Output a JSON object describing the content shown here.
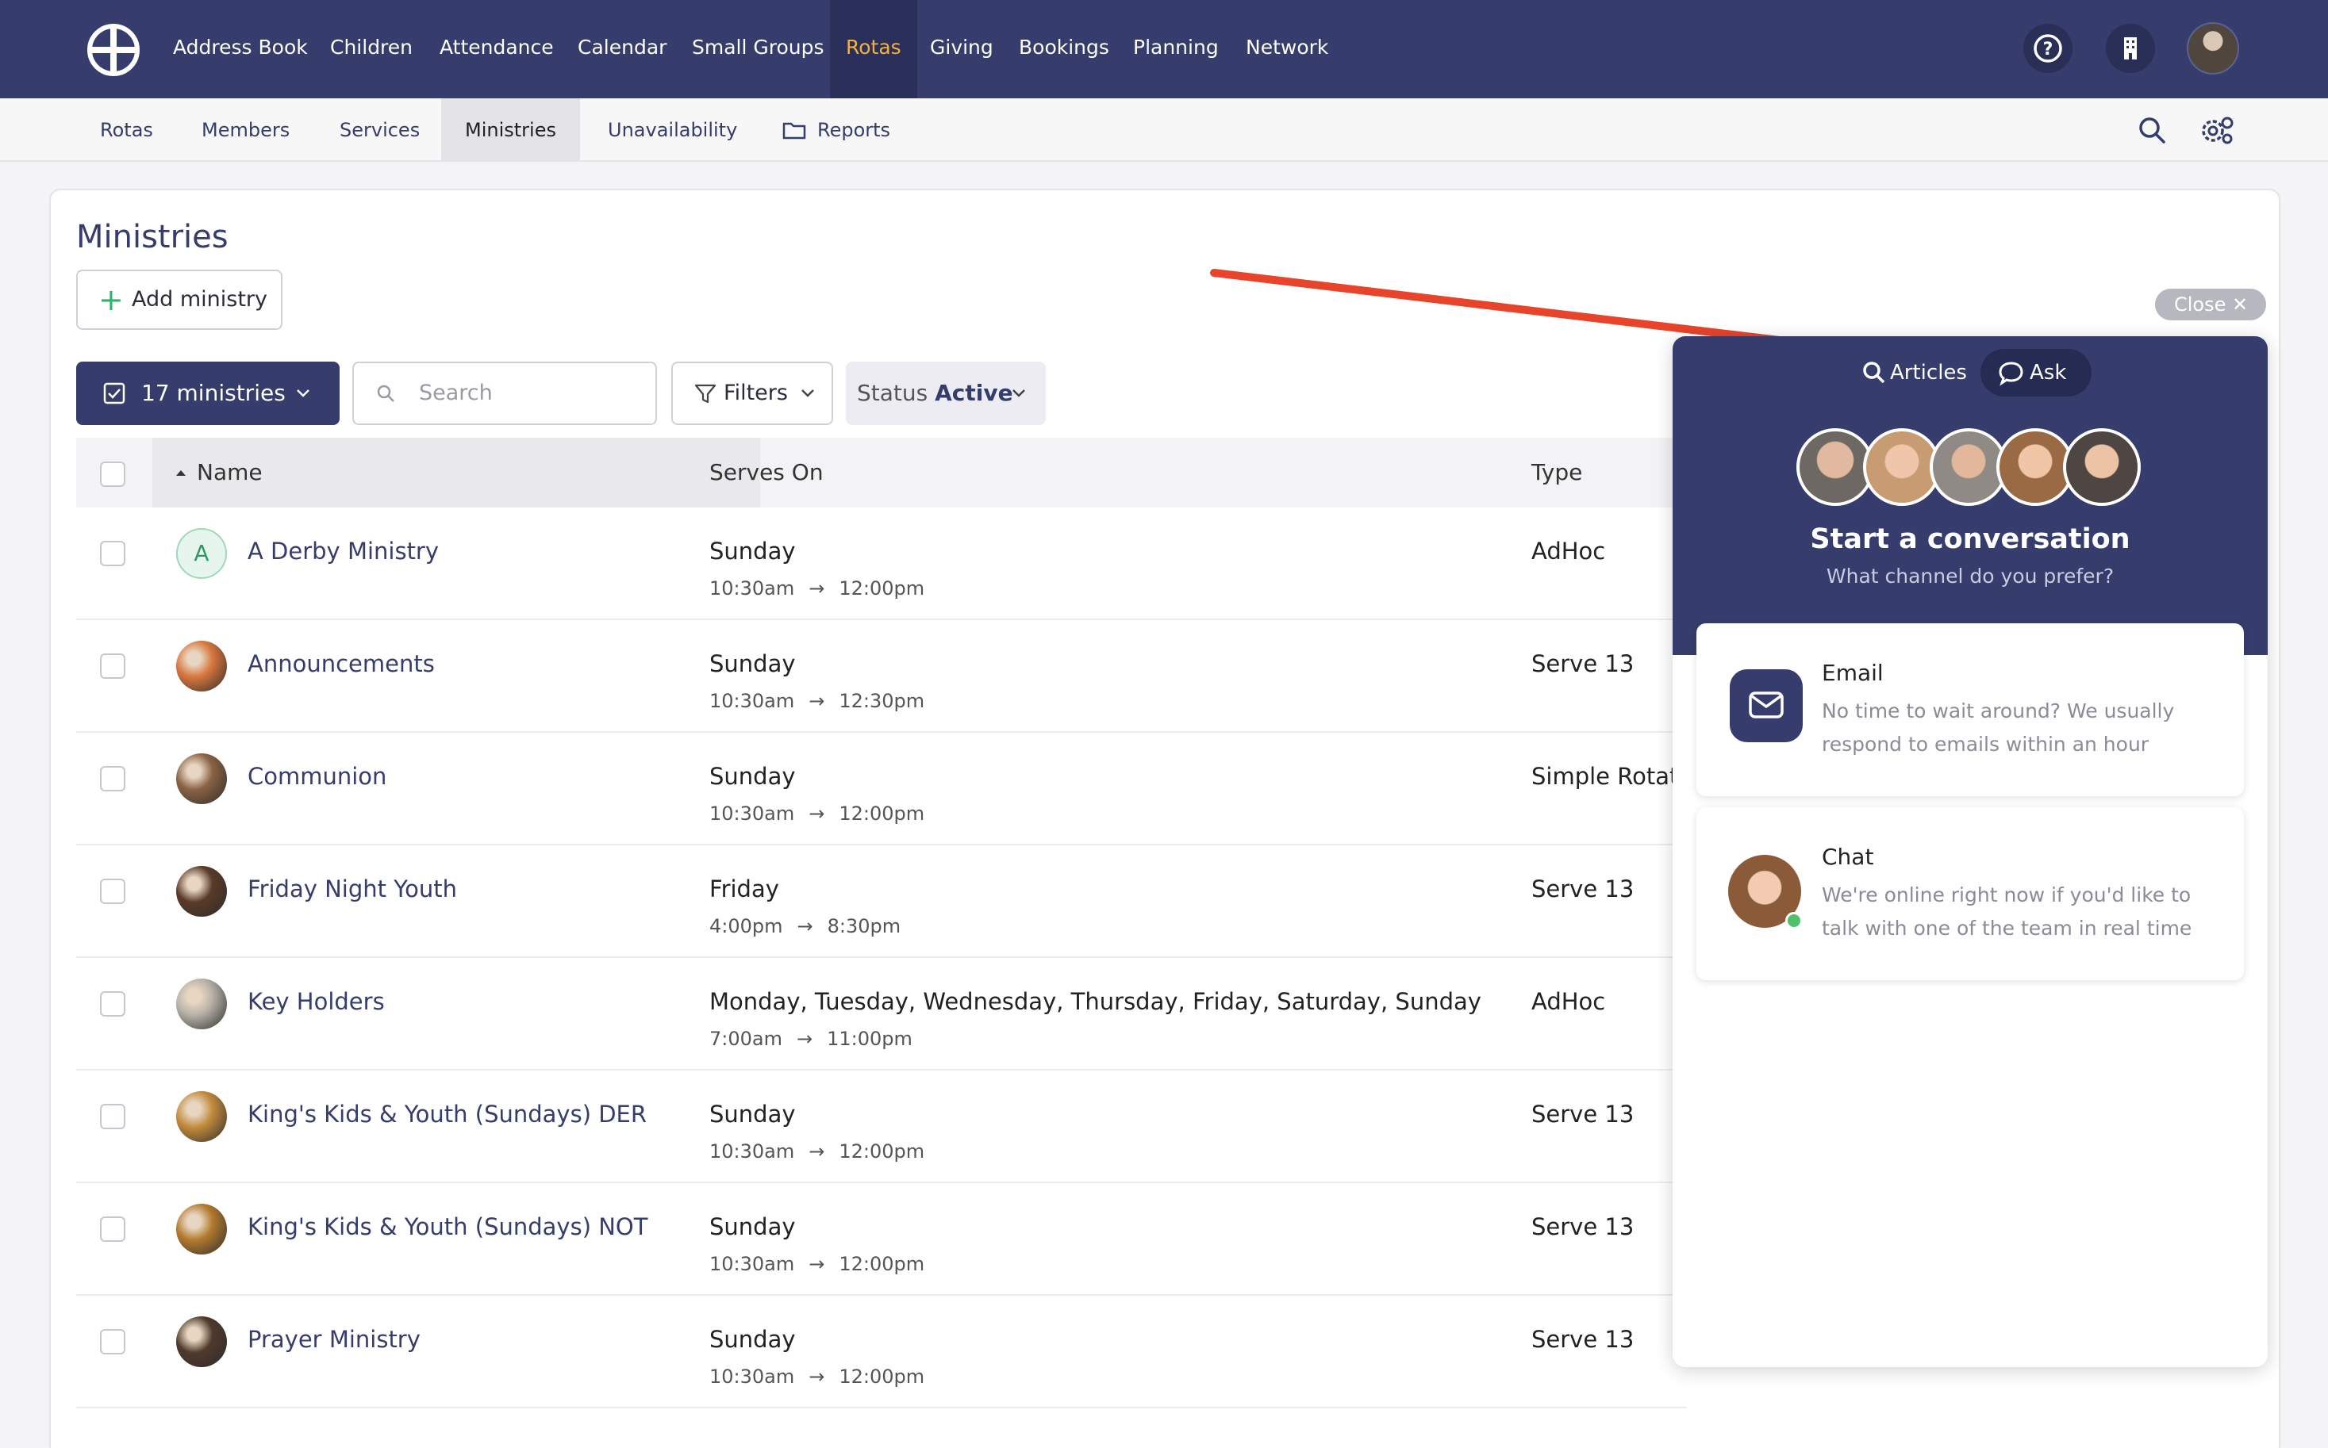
{
  "nav": {
    "items": [
      "Address Book",
      "Children",
      "Attendance",
      "Calendar",
      "Small Groups",
      "Rotas",
      "Giving",
      "Bookings",
      "Planning",
      "Network"
    ],
    "active": "Rotas",
    "icons": [
      "help-circle-icon",
      "building-icon",
      "user-avatar"
    ]
  },
  "subnav": {
    "items": [
      "Rotas",
      "Members",
      "Services",
      "Ministries",
      "Unavailability",
      "Reports"
    ],
    "active": "Ministries",
    "icons": [
      "search-icon",
      "gear-icon"
    ]
  },
  "page": {
    "title": "Ministries",
    "add_label": "Add ministry",
    "count_label": "17 ministries",
    "search_placeholder": "Search",
    "filters_label": "Filters",
    "status_label": "Status",
    "status_value": "Active"
  },
  "table": {
    "headers": {
      "name": "Name",
      "serves_on": "Serves On",
      "type": "Type"
    },
    "rows": [
      {
        "name": "A Derby Ministry",
        "initial": "A",
        "day": "Sunday",
        "start": "10:30am",
        "end": "12:00pm",
        "type": "AdHoc",
        "color": "#e6f6ee"
      },
      {
        "name": "Announcements",
        "initial": "",
        "day": "Sunday",
        "start": "10:30am",
        "end": "12:30pm",
        "type": "Serve 13",
        "color": "#d8763e"
      },
      {
        "name": "Communion",
        "initial": "",
        "day": "Sunday",
        "start": "10:30am",
        "end": "12:00pm",
        "type": "Simple Rotation",
        "color": "#8a6244"
      },
      {
        "name": "Friday Night Youth",
        "initial": "",
        "day": "Friday",
        "start": "4:00pm",
        "end": "8:30pm",
        "type": "Serve 13",
        "color": "#5a3a28"
      },
      {
        "name": "Key Holders",
        "initial": "",
        "day": "Monday, Tuesday, Wednesday, Thursday, Friday, Saturday, Sunday",
        "start": "7:00am",
        "end": "11:00pm",
        "type": "AdHoc",
        "color": "#b7b2a8"
      },
      {
        "name": "King's Kids & Youth (Sundays) DER",
        "initial": "",
        "day": "Sunday",
        "start": "10:30am",
        "end": "12:00pm",
        "type": "Serve 13",
        "color": "#c28b3c"
      },
      {
        "name": "King's Kids & Youth (Sundays) NOT",
        "initial": "",
        "day": "Sunday",
        "start": "10:30am",
        "end": "12:00pm",
        "type": "Serve 13",
        "color": "#b37a2e"
      },
      {
        "name": "Prayer Ministry",
        "initial": "",
        "day": "Sunday",
        "start": "10:30am",
        "end": "12:00pm",
        "type": "Serve 13",
        "color": "#4f3a2c"
      }
    ]
  },
  "widget": {
    "close_label": "Close",
    "tabs": [
      "Articles",
      "Ask"
    ],
    "active_tab": "Ask",
    "title": "Start a conversation",
    "subtitle": "What channel do you prefer?",
    "options": [
      {
        "title": "Email",
        "text": "No time to wait around? We usually respond to emails within an hour"
      },
      {
        "title": "Chat",
        "text": "We're online right now if you'd like to talk with one of the team in real time"
      }
    ]
  },
  "colors": {
    "brand": "#363c6b",
    "active_nav": "#f5b13c",
    "annotation_arrow": "#e8432b",
    "online": "#4cc36a"
  }
}
